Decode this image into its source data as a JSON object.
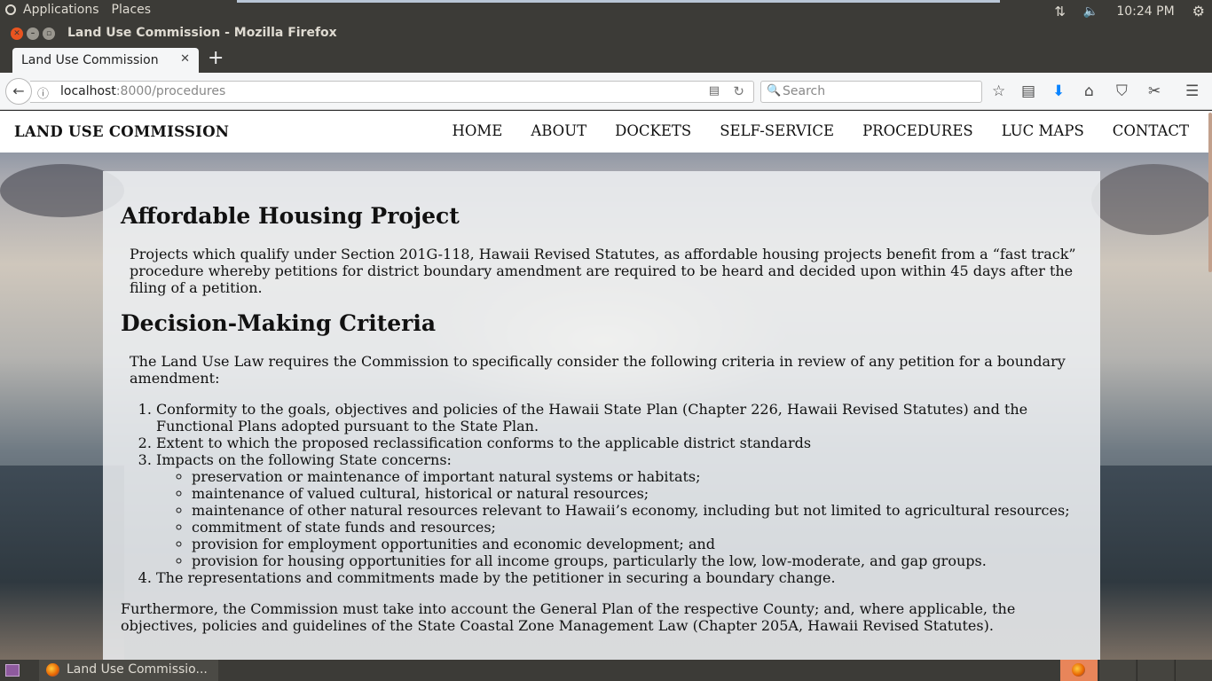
{
  "top_panel": {
    "menus": [
      "Applications",
      "Places"
    ],
    "clock": "10:24 PM"
  },
  "window": {
    "title": "Land Use Commission - Mozilla Firefox"
  },
  "tabs": [
    {
      "label": "Land Use Commission",
      "active": true
    }
  ],
  "nav": {
    "url_host": "localhost",
    "url_path": ":8000/procedures",
    "search_placeholder": "Search"
  },
  "site": {
    "title": "LAND USE COMMISSION",
    "nav_items": [
      "HOME",
      "ABOUT",
      "DOCKETS",
      "SELF-SERVICE",
      "PROCEDURES",
      "LUC MAPS",
      "CONTACT"
    ]
  },
  "content": {
    "heading1": "Affordable Housing Project",
    "paragraph1": "Projects which qualify under Section 201G-118, Hawaii Revised Statutes, as affordable housing projects benefit from a “fast track” procedure whereby petitions for district boundary amendment are required to be heard and decided upon within 45 days after the filing of a petition.",
    "heading2": "Decision-Making Criteria",
    "paragraph2": "The Land Use Law requires the Commission to specifically consider the following criteria in review of any petition for a boundary amendment:",
    "criteria": [
      "Conformity to the goals, objectives and policies of the Hawaii State Plan (Chapter 226, Hawaii Revised Statutes) and the Functional Plans adopted pursuant to the State Plan.",
      "Extent to which the proposed reclassification conforms to the applicable district standards",
      "Impacts on the following State concerns:",
      "The representations and commitments made by the petitioner in securing a boundary change."
    ],
    "state_concerns": [
      "preservation or maintenance of important natural systems or habitats;",
      "maintenance of valued cultural, historical or natural resources;",
      "maintenance of other natural resources relevant to Hawaii’s economy, including but not limited to agricultural resources;",
      "commitment of state funds and resources;",
      "provision for employment opportunities and economic development; and",
      "provision for housing opportunities for all income groups, particularly the low, low-moderate, and gap groups."
    ],
    "paragraph3": "Furthermore, the Commission must take into account the General Plan of the respective County; and, where applicable, the objectives, policies and guidelines of the State Coastal Zone Management Law (Chapter 205A, Hawaii Revised Statutes)."
  },
  "taskbar": {
    "task_label": "Land Use Commissio..."
  },
  "colors": {
    "panel_bg": "#3c3b37",
    "close_button": "#e95420",
    "download_arrow": "#0a84ff"
  }
}
